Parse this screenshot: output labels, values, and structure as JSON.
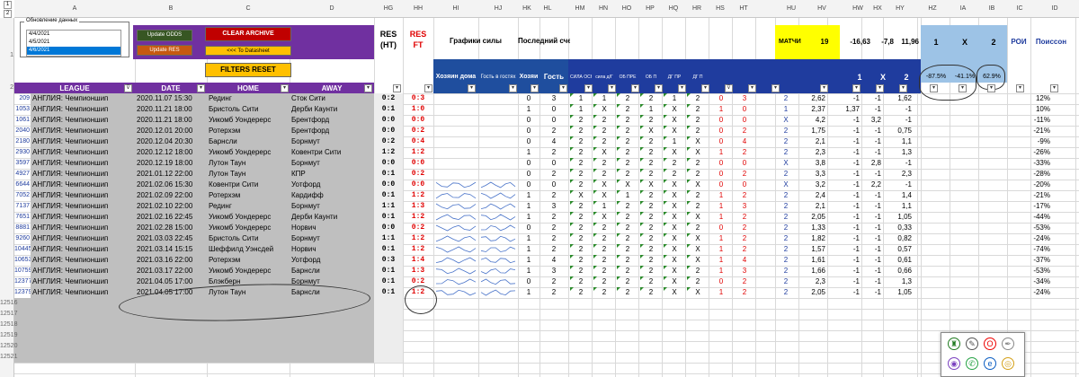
{
  "sheet": {
    "column_letters": [
      "A",
      "B",
      "C",
      "D",
      "HG",
      "HH",
      "HI",
      "HJ",
      "HK",
      "HL",
      "HM",
      "HN",
      "HO",
      "HP",
      "HQ",
      "HR",
      "HS",
      "HT",
      "HU",
      "HV",
      "HW",
      "HX",
      "HY",
      "HZ",
      "IA",
      "IB",
      "IC",
      "ID"
    ],
    "row_numbers_top": [
      "1",
      "2"
    ],
    "outline_levels": [
      "1",
      "2"
    ],
    "update_list": {
      "title": "Обновление данных",
      "items": [
        "4/4/2021",
        "4/5/2021",
        "4/6/2021"
      ],
      "selected_index": 2
    },
    "buttons": {
      "update_odds": "Update ODDS",
      "update_res": "Update RES",
      "clear_archive": "CLEAR ARCHIVE",
      "to_datasheet": "<<< To Datasheet",
      "filters_reset": "FILTERS RESET"
    },
    "header_row1": {
      "res_ht": "RES",
      "res_ht2": "(HT)",
      "res_ft": "RES",
      "res_ft2": "FT",
      "graphs": "Графики силы",
      "last_score": "Последний счет",
      "matches_label": "МАТЧИ",
      "matches_value": "19",
      "hv_value": "-16,63",
      "hx_value": "-7,8",
      "hy_value": "11,96",
      "hz_label": "1",
      "ia_label": "X",
      "ib_label": "2",
      "roi": "РОИ",
      "poisson": "Поиссон"
    },
    "header_row2": {
      "league": "LEAGUE",
      "date": "DATE",
      "home": "HOME",
      "away": "AWAY",
      "host_home": "Хозяин дома",
      "guest_away": "Гость в гостях",
      "hosts": "Хозяи",
      "guest": "Гость",
      "hm": "СИЛА ОСН",
      "hn": "сила д/Г",
      "ho": "ОБ ПРЕ",
      "hp": "ОБ П",
      "hq": "ДГ ПР",
      "hr": "ДГ П",
      "w1": "1",
      "wx": "X",
      "w2": "2",
      "pct1": "-87.5%",
      "pctx": "-41.1%",
      "pct2": "62.9%"
    },
    "rows": [
      {
        "n": "209",
        "league": "АНГЛИЯ: Чемпионшип",
        "date": "2020.11.07 15:30",
        "home": "Рединг",
        "away": "Сток Сити",
        "ht": "0:2",
        "ft": "0:3",
        "hk": "0",
        "hl": "3",
        "hm": "1",
        "hn": "1",
        "ho": "2",
        "hp": "2",
        "hq": "1",
        "hr": "2",
        "hs": "0",
        "ht2": "3",
        "hu": "2",
        "hv": "2,62",
        "hw": "-1",
        "hx": "-1",
        "hy": "1,62",
        "roi": "12%",
        "graph": false
      },
      {
        "n": "1053",
        "league": "АНГЛИЯ: Чемпионшип",
        "date": "2020.11.21 18:00",
        "home": "Бристоль Сити",
        "away": "Дерби Каунти",
        "ht": "0:1",
        "ft": "1:0",
        "hk": "1",
        "hl": "0",
        "hm": "1",
        "hn": "X",
        "ho": "2",
        "hp": "1",
        "hq": "X",
        "hr": "2",
        "hs": "1",
        "ht2": "0",
        "hu": "1",
        "hv": "2,37",
        "hw": "1,37",
        "hx": "-1",
        "hy": "-1",
        "roi": "10%",
        "graph": false
      },
      {
        "n": "1061",
        "league": "АНГЛИЯ: Чемпионшип",
        "date": "2020.11.21 18:00",
        "home": "Уикомб Уондерерс",
        "away": "Брентфорд",
        "ht": "0:0",
        "ft": "0:0",
        "hk": "0",
        "hl": "0",
        "hm": "2",
        "hn": "2",
        "ho": "2",
        "hp": "2",
        "hq": "X",
        "hr": "2",
        "hs": "0",
        "ht2": "0",
        "hu": "X",
        "hv": "4,2",
        "hw": "-1",
        "hx": "3,2",
        "hy": "-1",
        "roi": "-11%",
        "graph": false
      },
      {
        "n": "2040",
        "league": "АНГЛИЯ: Чемпионшип",
        "date": "2020.12.01 20:00",
        "home": "Ротерхэм",
        "away": "Брентфорд",
        "ht": "0:0",
        "ft": "0:2",
        "hk": "0",
        "hl": "2",
        "hm": "2",
        "hn": "2",
        "ho": "2",
        "hp": "X",
        "hq": "X",
        "hr": "2",
        "hs": "0",
        "ht2": "2",
        "hu": "2",
        "hv": "1,75",
        "hw": "-1",
        "hx": "-1",
        "hy": "0,75",
        "roi": "-21%",
        "graph": false
      },
      {
        "n": "2180",
        "league": "АНГЛИЯ: Чемпионшип",
        "date": "2020.12.04 20:30",
        "home": "Барнсли",
        "away": "Борнмут",
        "ht": "0:2",
        "ft": "0:4",
        "hk": "0",
        "hl": "4",
        "hm": "2",
        "hn": "2",
        "ho": "2",
        "hp": "2",
        "hq": "1",
        "hr": "X",
        "hs": "0",
        "ht2": "4",
        "hu": "2",
        "hv": "2,1",
        "hw": "-1",
        "hx": "-1",
        "hy": "1,1",
        "roi": "-9%",
        "graph": false
      },
      {
        "n": "2930",
        "league": "АНГЛИЯ: Чемпионшип",
        "date": "2020.12.12 18:00",
        "home": "Уикомб Уондерерс",
        "away": "Ковентри Сити",
        "ht": "1:2",
        "ft": "1:2",
        "hk": "1",
        "hl": "2",
        "hm": "2",
        "hn": "X",
        "ho": "2",
        "hp": "2",
        "hq": "X",
        "hr": "X",
        "hs": "1",
        "ht2": "2",
        "hu": "2",
        "hv": "2,3",
        "hw": "-1",
        "hx": "-1",
        "hy": "1,3",
        "roi": "-26%",
        "graph": false
      },
      {
        "n": "3597",
        "league": "АНГЛИЯ: Чемпионшип",
        "date": "2020.12.19 18:00",
        "home": "Лутон Таун",
        "away": "Борнмут",
        "ht": "0:0",
        "ft": "0:0",
        "hk": "0",
        "hl": "0",
        "hm": "2",
        "hn": "2",
        "ho": "2",
        "hp": "2",
        "hq": "2",
        "hr": "2",
        "hs": "0",
        "ht2": "0",
        "hu": "X",
        "hv": "3,8",
        "hw": "-1",
        "hx": "2,8",
        "hy": "-1",
        "roi": "-33%",
        "graph": false
      },
      {
        "n": "4927",
        "league": "АНГЛИЯ: Чемпионшип",
        "date": "2021.01.12 22:00",
        "home": "Лутон Таун",
        "away": "КПР",
        "ht": "0:1",
        "ft": "0:2",
        "hk": "0",
        "hl": "2",
        "hm": "2",
        "hn": "2",
        "ho": "2",
        "hp": "2",
        "hq": "2",
        "hr": "2",
        "hs": "0",
        "ht2": "2",
        "hu": "2",
        "hv": "3,3",
        "hw": "-1",
        "hx": "-1",
        "hy": "2,3",
        "roi": "-28%",
        "graph": false
      },
      {
        "n": "6644",
        "league": "АНГЛИЯ: Чемпионшип",
        "date": "2021.02.06 15:30",
        "home": "Ковентри Сити",
        "away": "Уотфорд",
        "ht": "0:0",
        "ft": "0:0",
        "hk": "0",
        "hl": "0",
        "hm": "2",
        "hn": "X",
        "ho": "X",
        "hp": "X",
        "hq": "X",
        "hr": "X",
        "hs": "0",
        "ht2": "0",
        "hu": "X",
        "hv": "3,2",
        "hw": "-1",
        "hx": "2,2",
        "hy": "-1",
        "roi": "-20%",
        "graph": true
      },
      {
        "n": "7052",
        "league": "АНГЛИЯ: Чемпионшип",
        "date": "2021.02.09 22:00",
        "home": "Ротерхэм",
        "away": "Кардифф",
        "ht": "0:1",
        "ft": "1:2",
        "hk": "1",
        "hl": "2",
        "hm": "X",
        "hn": "X",
        "ho": "1",
        "hp": "2",
        "hq": "X",
        "hr": "2",
        "hs": "1",
        "ht2": "2",
        "hu": "2",
        "hv": "2,4",
        "hw": "-1",
        "hx": "-1",
        "hy": "1,4",
        "roi": "-21%",
        "graph": true
      },
      {
        "n": "7137",
        "league": "АНГЛИЯ: Чемпионшип",
        "date": "2021.02.10 22:00",
        "home": "Рединг",
        "away": "Борнмут",
        "ht": "1:1",
        "ft": "1:3",
        "hk": "1",
        "hl": "3",
        "hm": "2",
        "hn": "1",
        "ho": "2",
        "hp": "2",
        "hq": "X",
        "hr": "2",
        "hs": "1",
        "ht2": "3",
        "hu": "2",
        "hv": "2,1",
        "hw": "-1",
        "hx": "-1",
        "hy": "1,1",
        "roi": "-17%",
        "graph": true
      },
      {
        "n": "7651",
        "league": "АНГЛИЯ: Чемпионшип",
        "date": "2021.02.16 22:45",
        "home": "Уикомб Уондерерс",
        "away": "Дерби Каунти",
        "ht": "0:1",
        "ft": "1:2",
        "hk": "1",
        "hl": "2",
        "hm": "2",
        "hn": "X",
        "ho": "2",
        "hp": "2",
        "hq": "X",
        "hr": "X",
        "hs": "1",
        "ht2": "2",
        "hu": "2",
        "hv": "2,05",
        "hw": "-1",
        "hx": "-1",
        "hy": "1,05",
        "roi": "-44%",
        "graph": true
      },
      {
        "n": "8881",
        "league": "АНГЛИЯ: Чемпионшип",
        "date": "2021.02.28 15:00",
        "home": "Уикомб Уондерерс",
        "away": "Норвич",
        "ht": "0:0",
        "ft": "0:2",
        "hk": "0",
        "hl": "2",
        "hm": "2",
        "hn": "2",
        "ho": "2",
        "hp": "2",
        "hq": "X",
        "hr": "2",
        "hs": "0",
        "ht2": "2",
        "hu": "2",
        "hv": "1,33",
        "hw": "-1",
        "hx": "-1",
        "hy": "0,33",
        "roi": "-53%",
        "graph": true
      },
      {
        "n": "9260",
        "league": "АНГЛИЯ: Чемпионшип",
        "date": "2021.03.03 22:45",
        "home": "Бристоль Сити",
        "away": "Борнмут",
        "ht": "1:1",
        "ft": "1:2",
        "hk": "1",
        "hl": "2",
        "hm": "2",
        "hn": "2",
        "ho": "2",
        "hp": "2",
        "hq": "X",
        "hr": "X",
        "hs": "1",
        "ht2": "2",
        "hu": "2",
        "hv": "1,82",
        "hw": "-1",
        "hx": "-1",
        "hy": "0,82",
        "roi": "-24%",
        "graph": true
      },
      {
        "n": "10445",
        "league": "АНГЛИЯ: Чемпионшип",
        "date": "2021.03.14 15:15",
        "home": "Шеффилд Уэнсдей",
        "away": "Норвич",
        "ht": "0:1",
        "ft": "1:2",
        "hk": "1",
        "hl": "2",
        "hm": "2",
        "hn": "2",
        "ho": "2",
        "hp": "2",
        "hq": "X",
        "hr": "X",
        "hs": "1",
        "ht2": "2",
        "hu": "2",
        "hv": "1,57",
        "hw": "-1",
        "hx": "-1",
        "hy": "0,57",
        "roi": "-74%",
        "graph": true
      },
      {
        "n": "10653",
        "league": "АНГЛИЯ: Чемпионшип",
        "date": "2021.03.16 22:00",
        "home": "Ротерхэм",
        "away": "Уотфорд",
        "ht": "0:3",
        "ft": "1:4",
        "hk": "1",
        "hl": "4",
        "hm": "2",
        "hn": "2",
        "ho": "2",
        "hp": "2",
        "hq": "X",
        "hr": "X",
        "hs": "1",
        "ht2": "4",
        "hu": "2",
        "hv": "1,61",
        "hw": "-1",
        "hx": "-1",
        "hy": "0,61",
        "roi": "-37%",
        "graph": true
      },
      {
        "n": "10759",
        "league": "АНГЛИЯ: Чемпионшип",
        "date": "2021.03.17 22:00",
        "home": "Уикомб Уондерерс",
        "away": "Барнсли",
        "ht": "0:1",
        "ft": "1:3",
        "hk": "1",
        "hl": "3",
        "hm": "2",
        "hn": "2",
        "ho": "2",
        "hp": "2",
        "hq": "X",
        "hr": "2",
        "hs": "1",
        "ht2": "3",
        "hu": "2",
        "hv": "1,66",
        "hw": "-1",
        "hx": "-1",
        "hy": "0,66",
        "roi": "-53%",
        "graph": true
      },
      {
        "n": "12377",
        "league": "АНГЛИЯ: Чемпионшип",
        "date": "2021.04.05 17:00",
        "home": "Блэкберн",
        "away": "Борнмут",
        "ht": "0:1",
        "ft": "0:2",
        "hk": "0",
        "hl": "2",
        "hm": "2",
        "hn": "2",
        "ho": "2",
        "hp": "2",
        "hq": "X",
        "hr": "2",
        "hs": "0",
        "ht2": "2",
        "hu": "2",
        "hv": "2,3",
        "hw": "-1",
        "hx": "-1",
        "hy": "1,3",
        "roi": "-34%",
        "graph": true
      },
      {
        "n": "12379",
        "league": "АНГЛИЯ: Чемпионшип",
        "date": "2021.04.05 17:00",
        "home": "Лутон Таун",
        "away": "Барнсли",
        "ht": "0:1",
        "ft": "1:2",
        "hk": "1",
        "hl": "2",
        "hm": "2",
        "hn": "2",
        "ho": "2",
        "hp": "2",
        "hq": "X",
        "hr": "X",
        "hs": "1",
        "ht2": "2",
        "hu": "2",
        "hv": "2,05",
        "hw": "-1",
        "hx": "-1",
        "hy": "1,05",
        "roi": "-24%",
        "graph": true
      }
    ],
    "empty_rows": [
      "12516",
      "12517",
      "12518",
      "12519",
      "12520",
      "12521"
    ]
  },
  "taskbar_popup": {
    "icons": [
      "app-icon-1",
      "feather-icon",
      "opera-icon",
      "pen-icon",
      "app-icon-5",
      "whatsapp-icon",
      "edge-icon",
      "chrome-icon"
    ]
  }
}
